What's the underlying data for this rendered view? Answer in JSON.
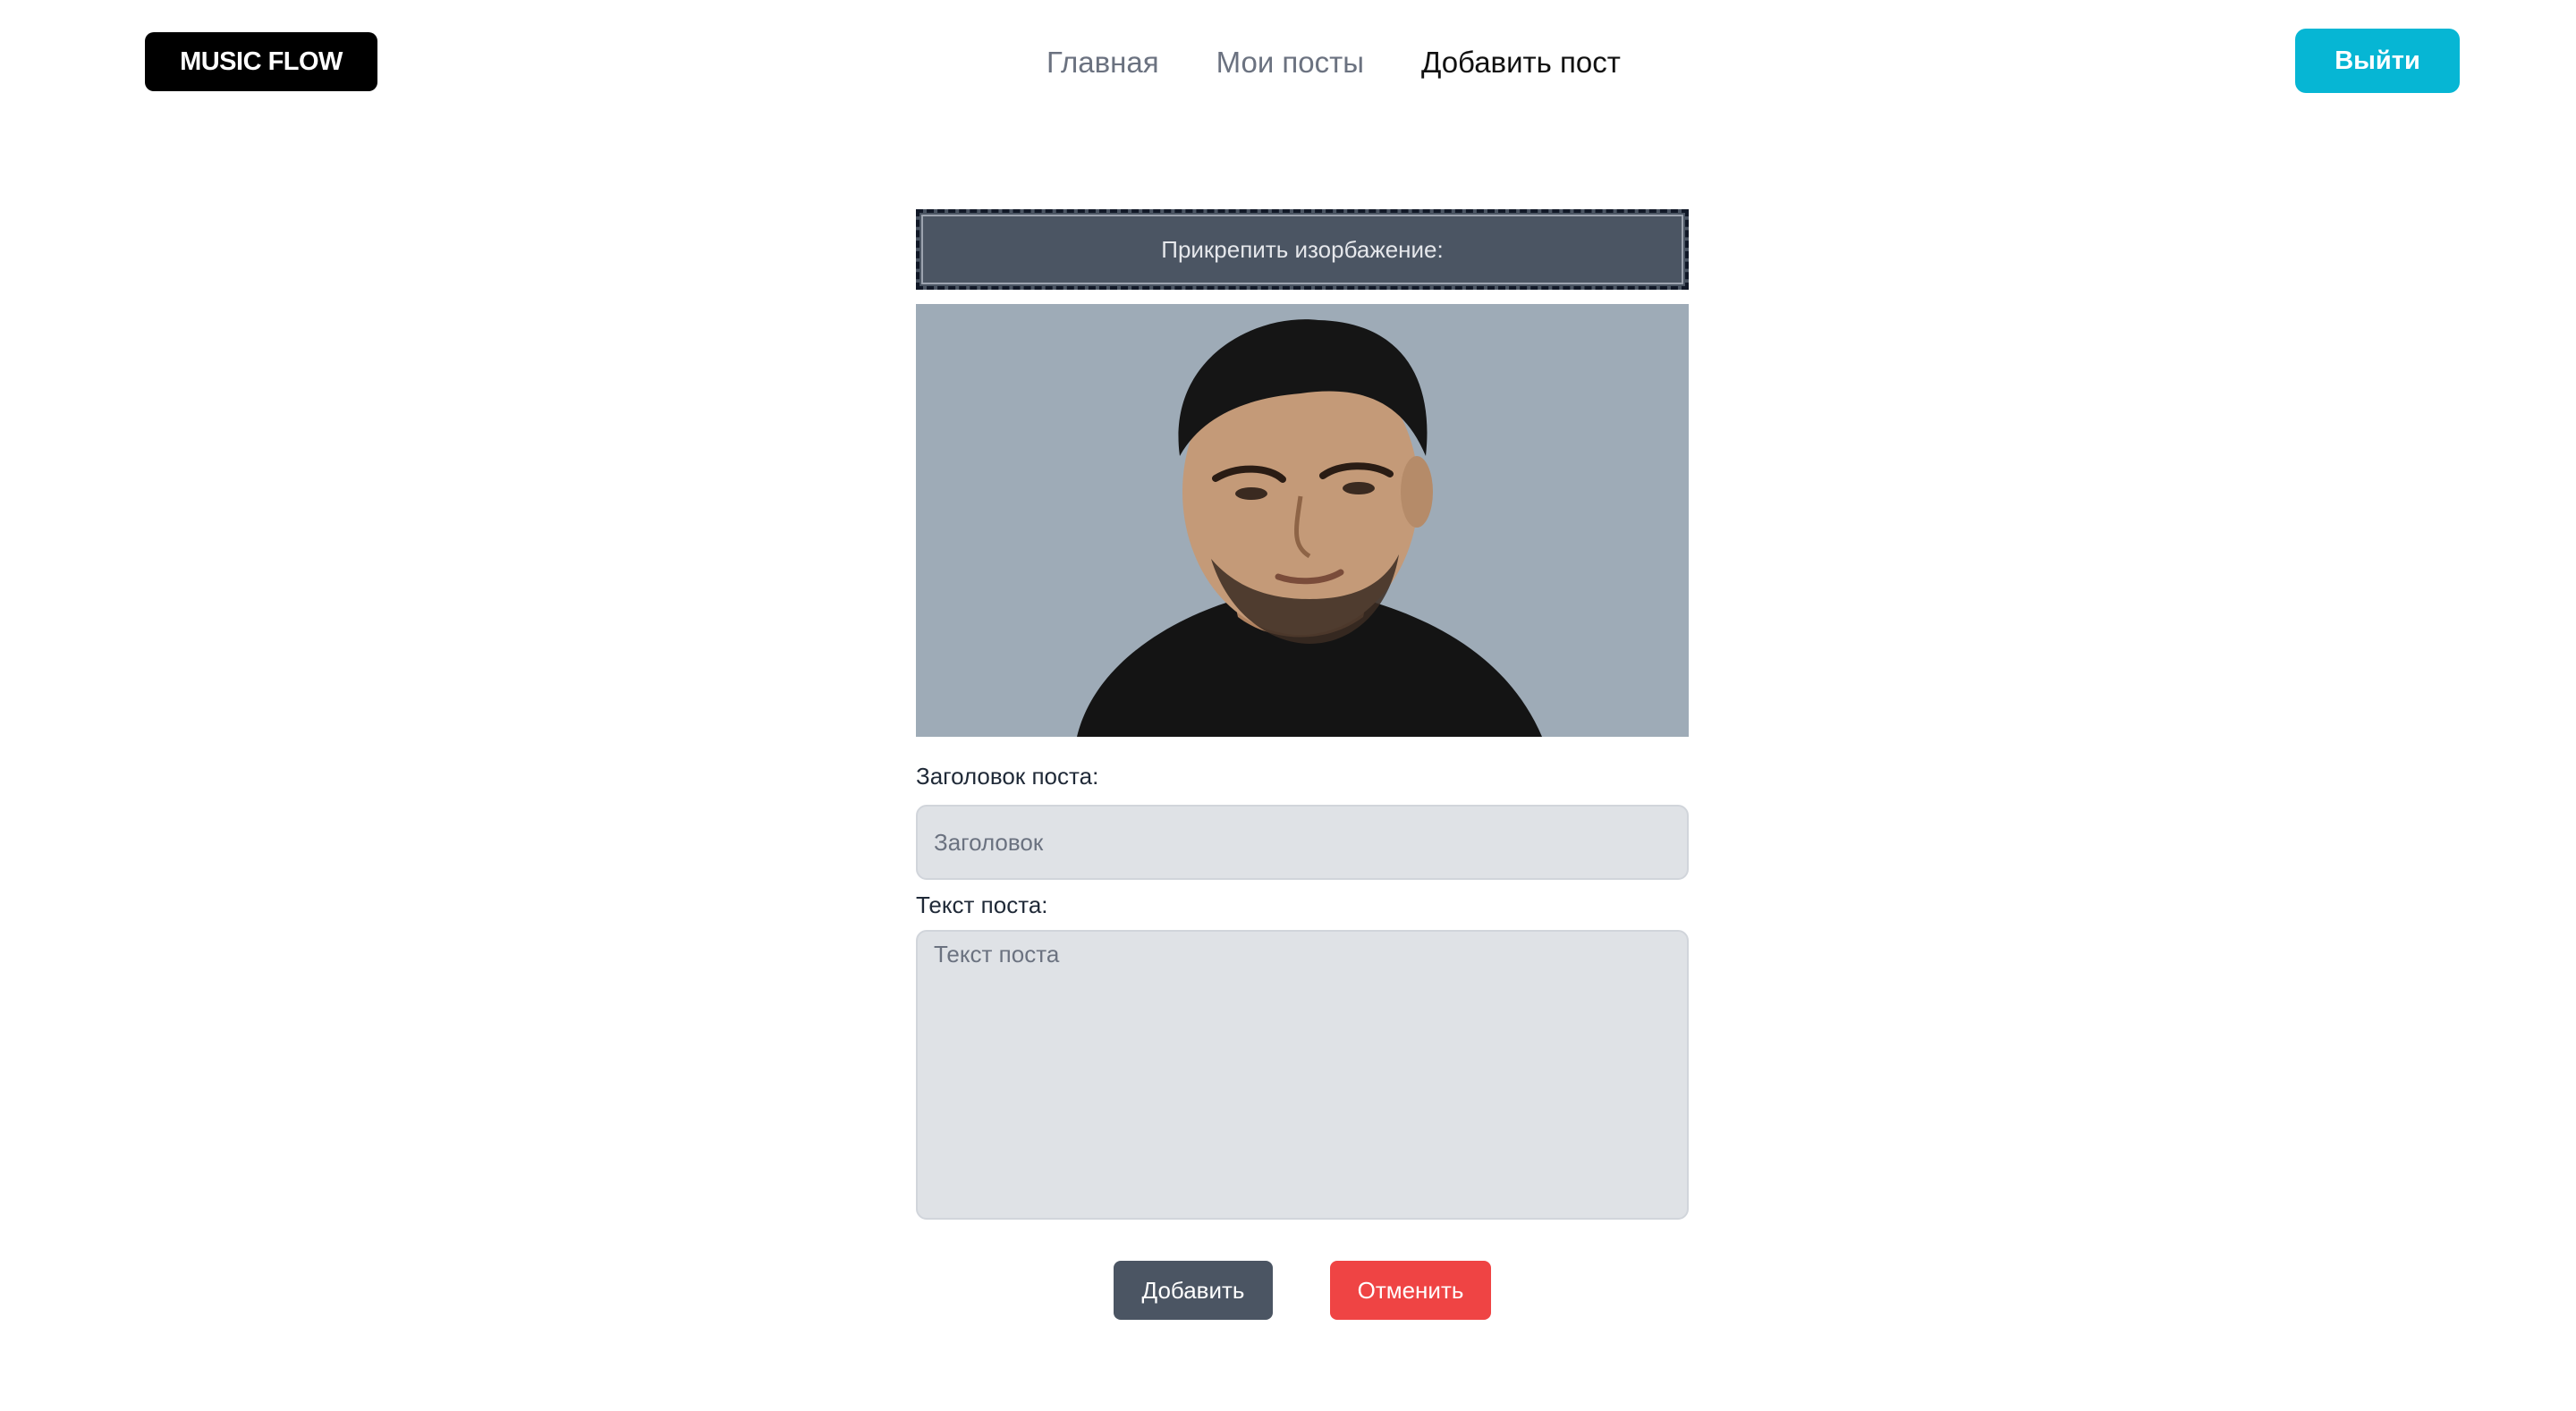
{
  "header": {
    "logo": "MUSIC FLOW",
    "nav": [
      {
        "label": "Главная",
        "active": false
      },
      {
        "label": "Мои посты",
        "active": false
      },
      {
        "label": "Добавить пост",
        "active": true
      }
    ],
    "logout_label": "Выйти"
  },
  "form": {
    "attach_label": "Прикрепить изорбажение:",
    "title_label": "Заголовок поста:",
    "title_placeholder": "Заголовок",
    "title_value": "",
    "text_label": "Текст поста:",
    "text_placeholder": "Текст поста",
    "text_value": "",
    "submit_label": "Добавить",
    "cancel_label": "Отменить"
  },
  "colors": {
    "logout": "#06b6d4",
    "attach_bg": "#4b5563",
    "submit": "#4b5563",
    "cancel": "#ef4444",
    "preview_bg": "#9eabb7"
  }
}
